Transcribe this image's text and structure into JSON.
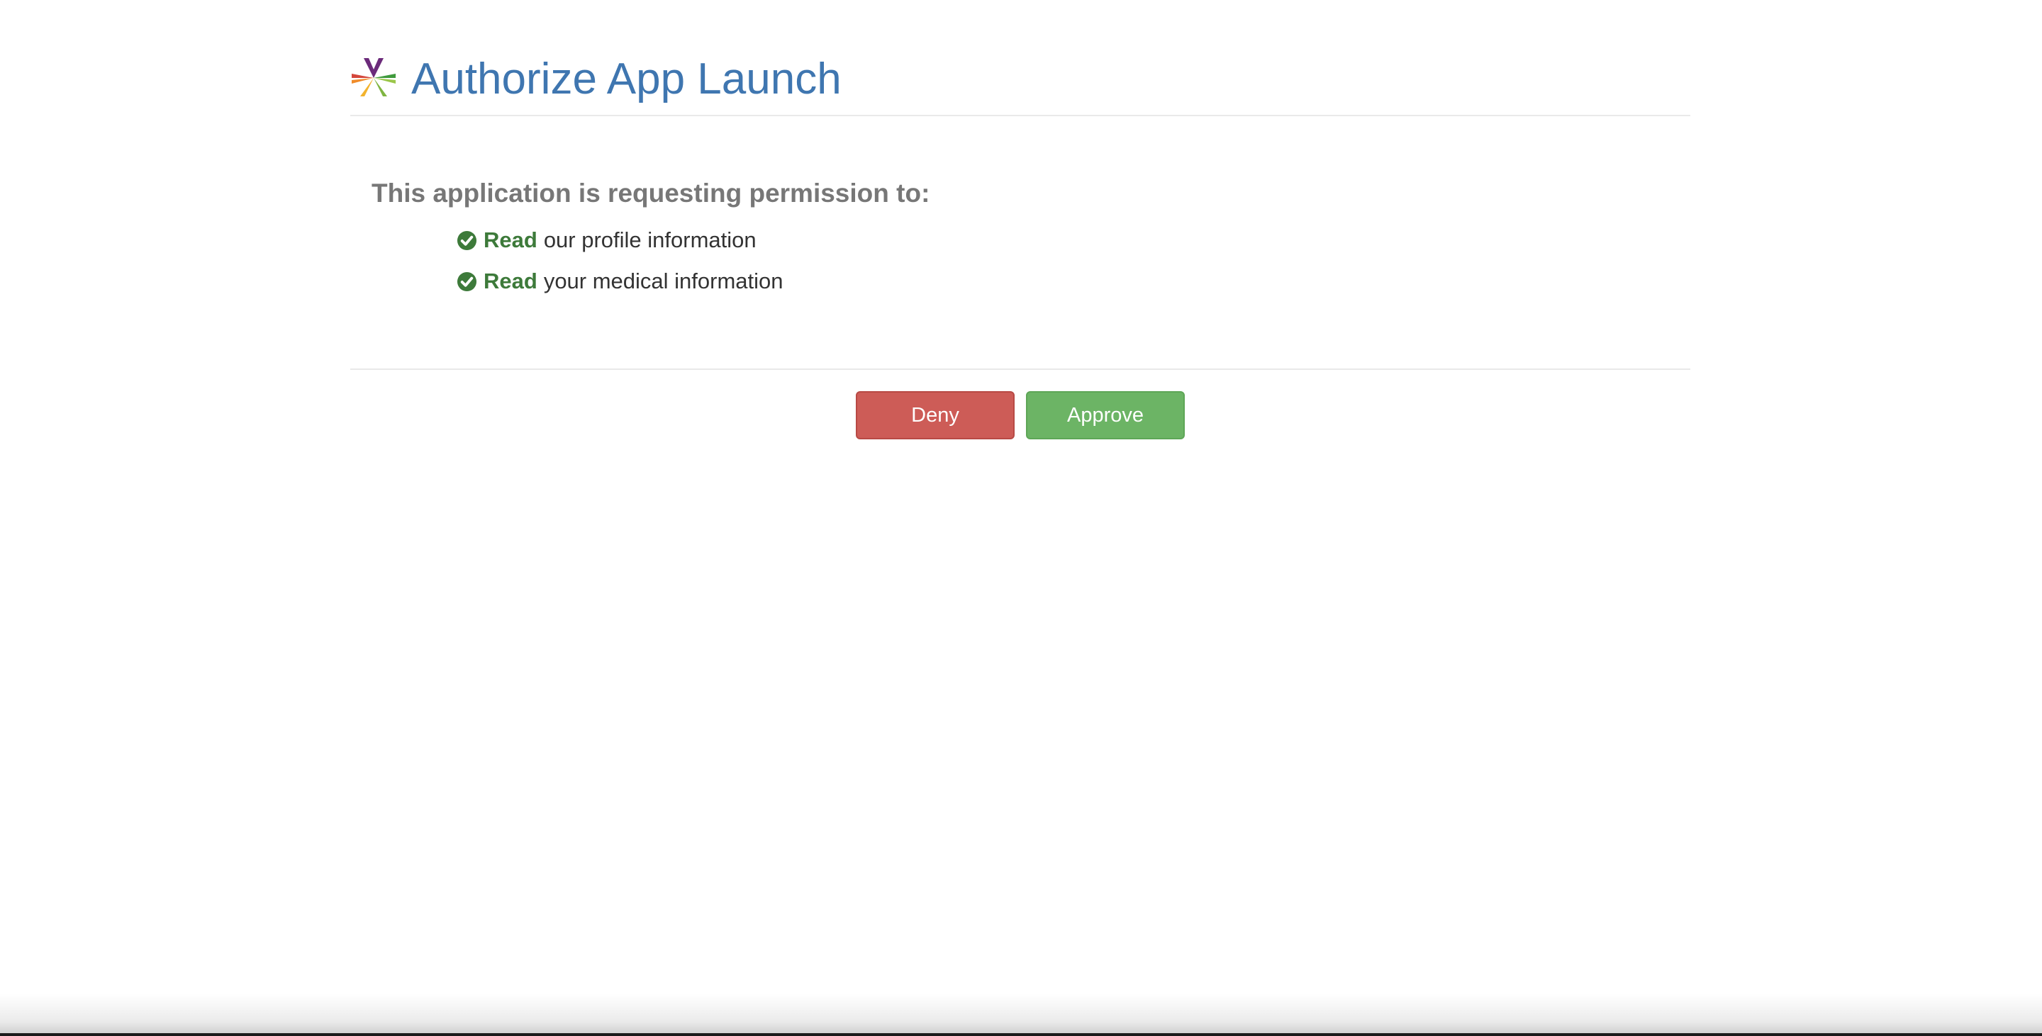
{
  "header": {
    "title": "Authorize App Launch",
    "logo_icon": "smart-logo-icon"
  },
  "request": {
    "prompt": "This application is requesting permission to:",
    "permissions": [
      {
        "verb": "Read",
        "description": "our profile information",
        "icon": "check-circle-icon"
      },
      {
        "verb": "Read",
        "description": "your medical information",
        "icon": "check-circle-icon"
      }
    ]
  },
  "actions": {
    "deny_label": "Deny",
    "approve_label": "Approve"
  },
  "colors": {
    "title": "#3f76b0",
    "permission_verb": "#3d7a3a",
    "deny": "#cd5c57",
    "approve": "#6cb465"
  }
}
